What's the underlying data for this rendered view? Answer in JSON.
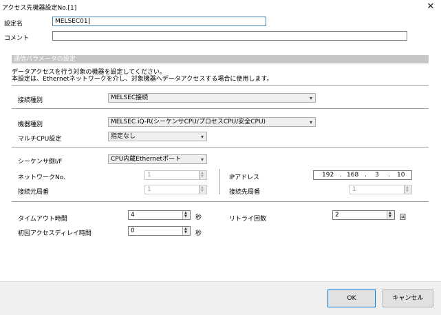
{
  "window": {
    "title": "アクセス先機器設定No.[1]",
    "close_label": "✕"
  },
  "name_field": {
    "label": "設定名",
    "value": "MELSEC01"
  },
  "comment_field": {
    "label": "コメント",
    "value": ""
  },
  "section": {
    "title": "通信パラメータの設定",
    "description_line1": "データアクセスを行う対象の機器を設定してください。",
    "description_line2": "本設定は、Ethernetネットワークを介し、対象機器へデータアクセスする場合に使用します。"
  },
  "connection_type": {
    "label": "接続種別",
    "value": "MELSEC接続"
  },
  "device_type": {
    "label": "機器種別",
    "value": "MELSEC iQ-R(シーケンサCPU/プロセスCPU/安全CPU)"
  },
  "multi_cpu": {
    "label": "マルチCPU設定",
    "value": "指定なし"
  },
  "sequencer_if": {
    "label": "シーケンサ側I/F",
    "value": "CPU内蔵Ethernetポート"
  },
  "network_no": {
    "label": "ネットワークNo.",
    "value": "1"
  },
  "source_station": {
    "label": "接続元局番",
    "value": "1"
  },
  "ip_address": {
    "label": "IPアドレス",
    "octets": [
      "192",
      "168",
      "3",
      "10"
    ],
    "dot": "."
  },
  "dest_station": {
    "label": "接続先局番",
    "value": "1"
  },
  "timeout": {
    "label": "タイムアウト時間",
    "value": "4",
    "unit": "秒"
  },
  "retry": {
    "label": "リトライ回数",
    "value": "2",
    "unit": "回"
  },
  "initial_delay": {
    "label": "初回アクセスディレイ時間",
    "value": "0",
    "unit": "秒"
  },
  "buttons": {
    "ok": "OK",
    "cancel": "キャンセル"
  },
  "icons": {
    "dropdown": "▾",
    "spin_up": "▲",
    "spin_down": "▼"
  }
}
